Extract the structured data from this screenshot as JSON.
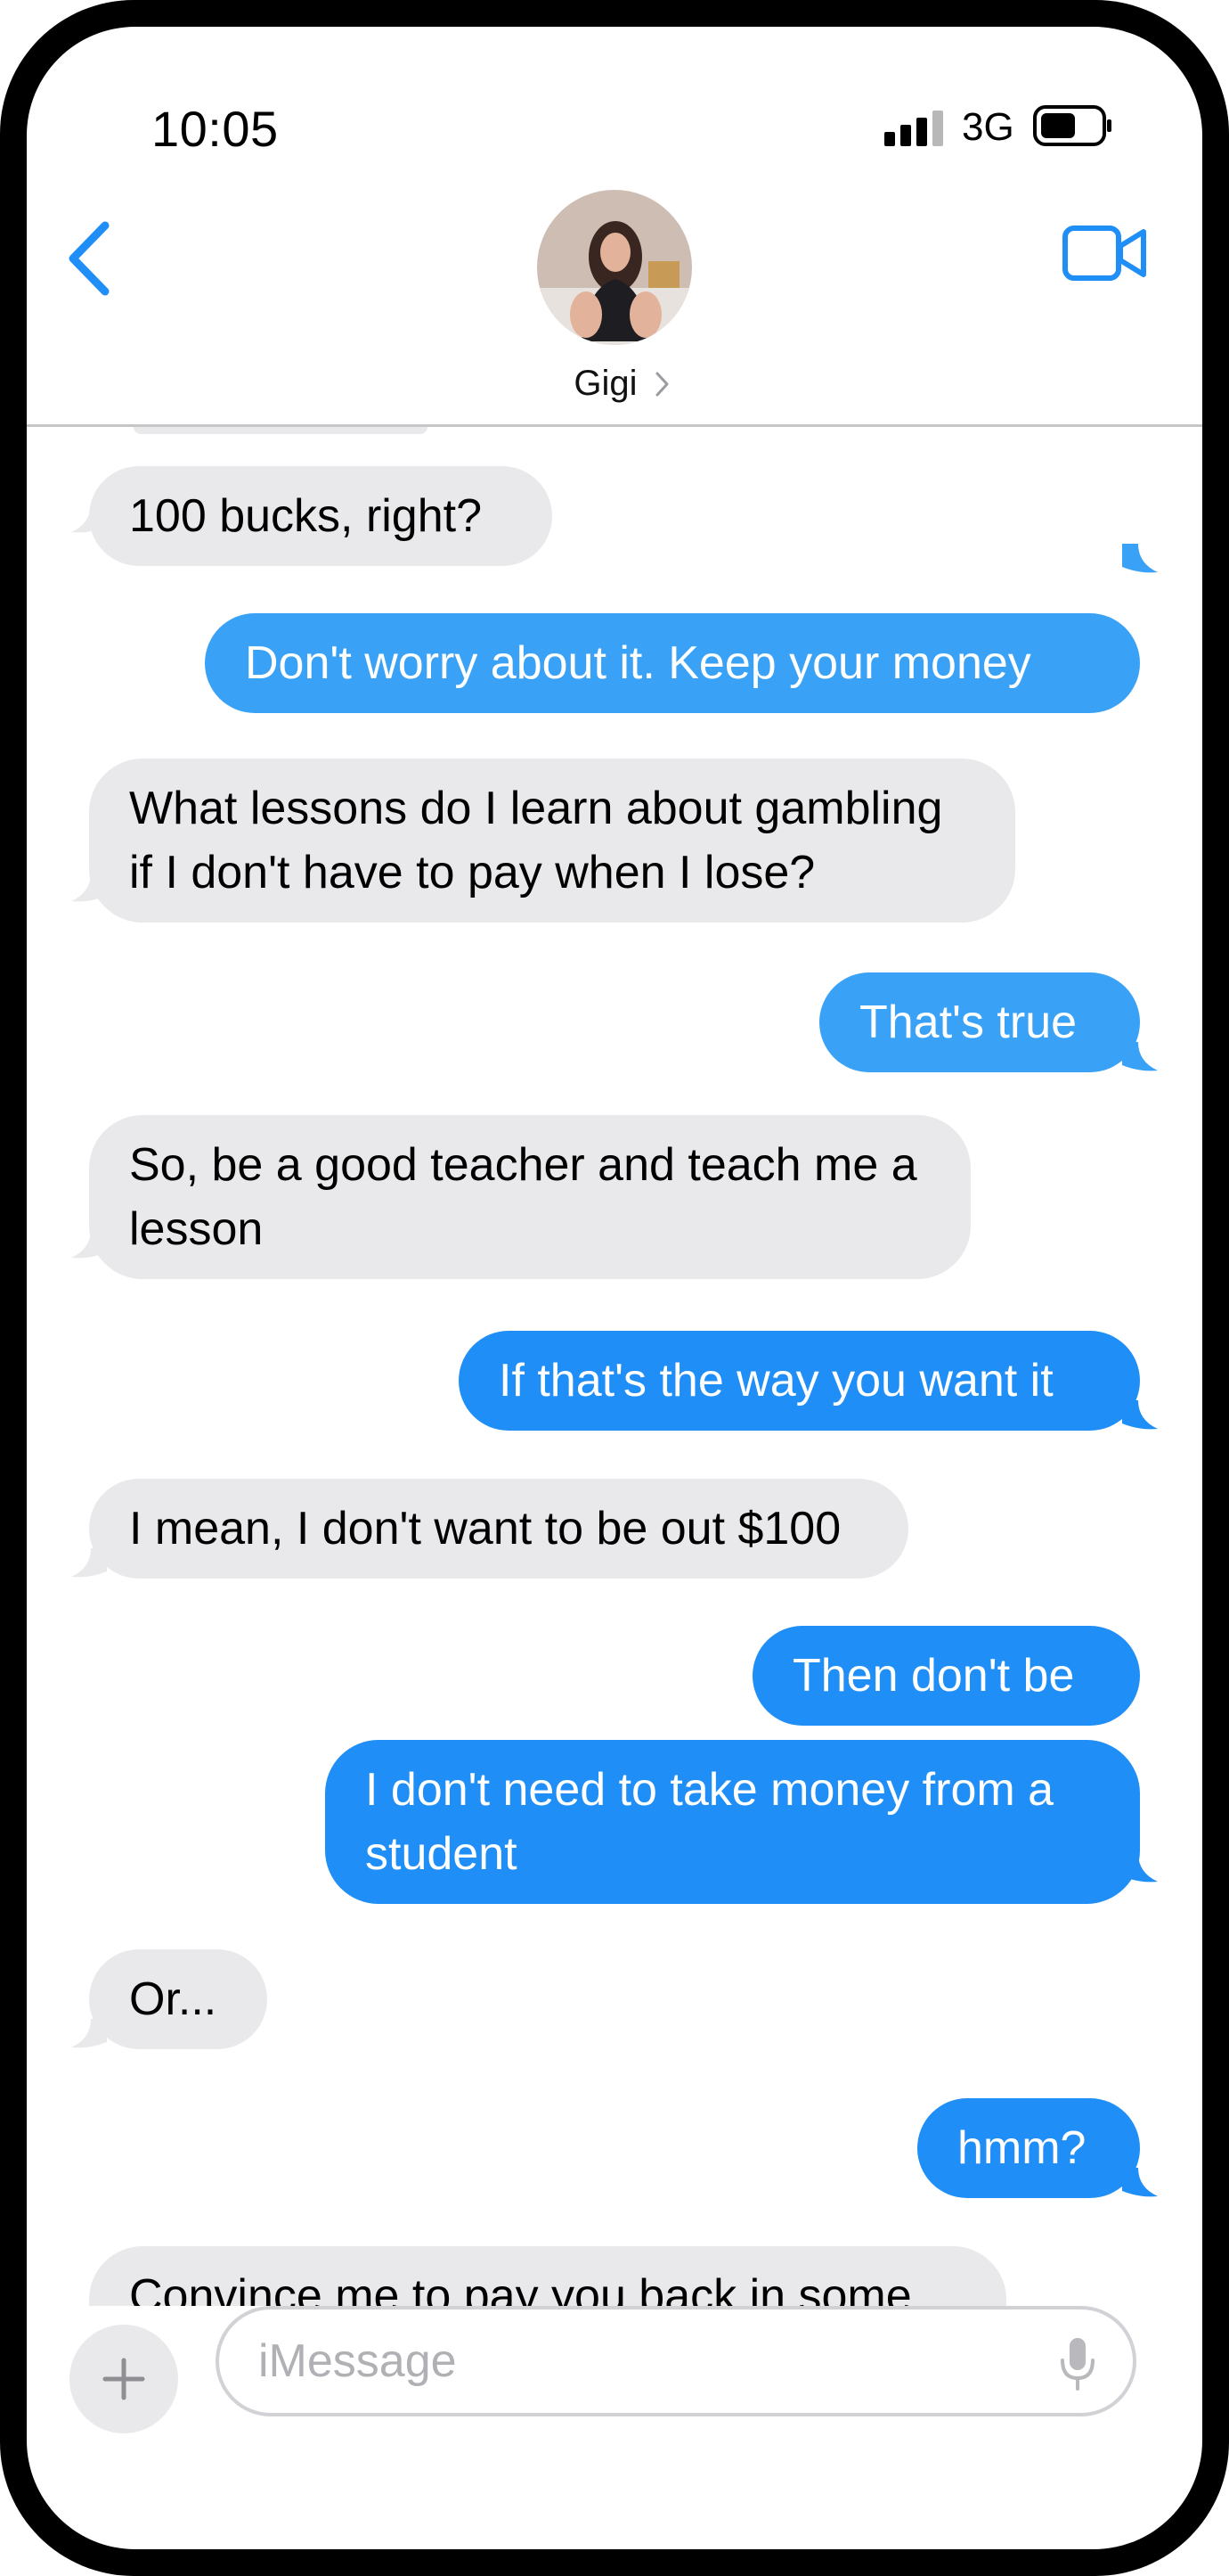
{
  "status_bar": {
    "time": "10:05",
    "network": "3G"
  },
  "header": {
    "contact_name": "Gigi",
    "icons": [
      "back-chevron-icon",
      "contact-avatar",
      "disclosure-chevron-icon",
      "video-camera-icon"
    ]
  },
  "colors": {
    "accent": "#1f8ef6",
    "incoming_bubble": "#e9e9eb",
    "outgoing_bubble": "#1f8ef6",
    "outgoing_bubble_light": "#39a2f7"
  },
  "messages": [
    {
      "direction": "in",
      "text": "100 bucks, right?"
    },
    {
      "direction": "out",
      "text": "Don't worry about it.  Keep your money"
    },
    {
      "direction": "in",
      "text": "What lessons do I learn about gambling if I don't have to pay when I lose?"
    },
    {
      "direction": "out",
      "text": "That's true"
    },
    {
      "direction": "in",
      "text": "So, be a good teacher and teach me a lesson"
    },
    {
      "direction": "out",
      "text": "If that's the way you want it"
    },
    {
      "direction": "in",
      "text": "I mean, I don't want to be out $100"
    },
    {
      "direction": "out",
      "text": "Then don't be"
    },
    {
      "direction": "out",
      "text": "I don't need to take money from a student"
    },
    {
      "direction": "in",
      "text": "Or..."
    },
    {
      "direction": "out",
      "text": "hmm?"
    },
    {
      "direction": "in",
      "text": "Convince me to pay you back in some"
    }
  ],
  "composer": {
    "placeholder": "iMessage",
    "icons": [
      "plus-icon",
      "microphone-icon"
    ]
  }
}
